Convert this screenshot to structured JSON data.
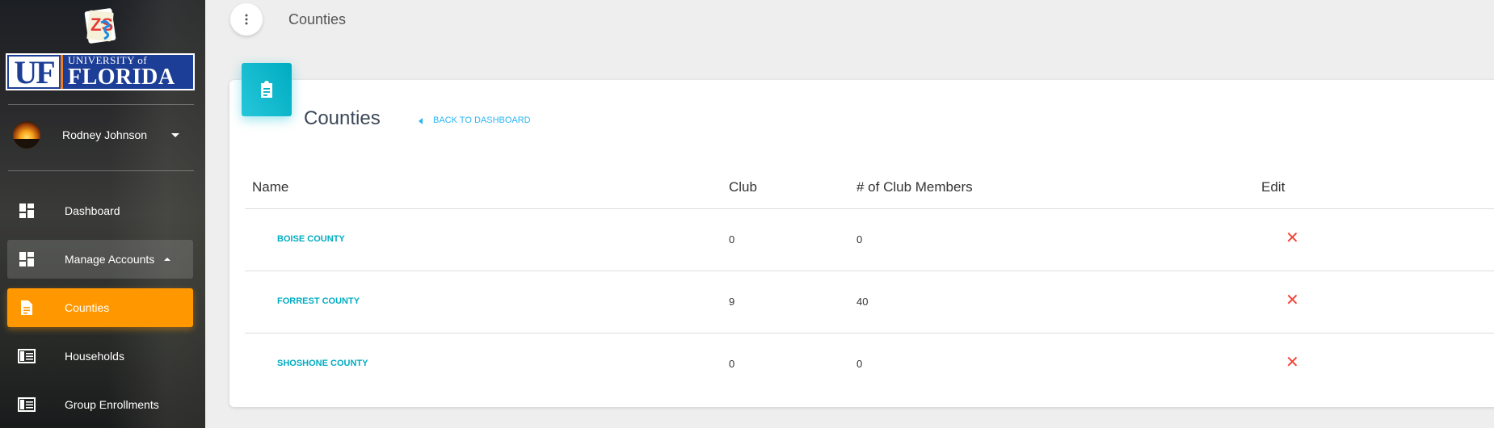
{
  "sidebar": {
    "logo_text": "ZS",
    "uf_logo": {
      "left": "UF",
      "top": "UNIVERSITY of",
      "bottom": "FLORIDA"
    },
    "user": {
      "name": "Rodney Johnson"
    },
    "items": [
      {
        "label": "Dashboard",
        "icon": "dashboard-icon"
      },
      {
        "label": "Manage Accounts",
        "icon": "dashboard-icon"
      },
      {
        "label": "Counties",
        "icon": "document-icon"
      },
      {
        "label": "Households",
        "icon": "list-card-icon"
      },
      {
        "label": "Group Enrollments",
        "icon": "list-card-icon"
      }
    ]
  },
  "topbar": {
    "title": "Counties"
  },
  "card": {
    "title": "Counties",
    "back_label": "BACK TO DASHBOARD",
    "columns": [
      "Name",
      "Club",
      "# of Club Members",
      "Edit"
    ],
    "rows": [
      {
        "name": "BOISE COUNTY",
        "club": "0",
        "members": "0",
        "edit": "✕"
      },
      {
        "name": "FORREST COUNTY",
        "club": "9",
        "members": "40",
        "edit": "✕"
      },
      {
        "name": "SHOSHONE COUNTY",
        "club": "0",
        "members": "0",
        "edit": "✕"
      }
    ]
  },
  "colors": {
    "accent": "#ff9800",
    "card_icon": "#00acc1",
    "link": "#00acc1",
    "delete": "#f44336"
  }
}
